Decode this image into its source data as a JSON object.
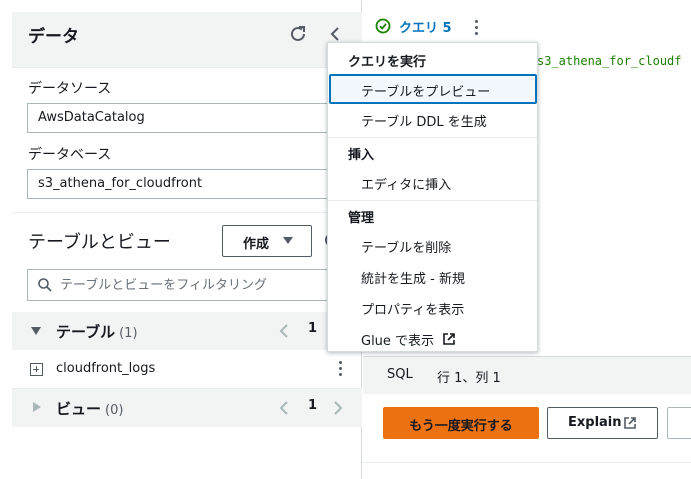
{
  "left_panel": {
    "title": "データ",
    "data_source_label": "データソース",
    "data_source_value": "AwsDataCatalog",
    "database_label": "データベース",
    "database_value": "s3_athena_for_cloudfront",
    "tables_views_title": "テーブルとビュー",
    "create_label": "作成",
    "search_placeholder": "テーブルとビューをフィルタリング",
    "tables": {
      "label": "テーブル",
      "count": "(1)",
      "page": "1",
      "items": [
        "cloudfront_logs"
      ]
    },
    "views": {
      "label": "ビュー",
      "count": "(0)",
      "page": "1"
    }
  },
  "editor": {
    "tab_label": "クエリ 5",
    "code_snippet": "s3_athena_for_cloudf",
    "status_mode": "SQL",
    "status_position": "行 1、列 1",
    "run_again_label": "もう一度実行する",
    "explain_label": "Explain"
  },
  "context_menu": {
    "group_run": "クエリを実行",
    "preview_table": "テーブルをプレビュー",
    "generate_ddl": "テーブル DDL を生成",
    "group_insert": "挿入",
    "insert_editor": "エディタに挿入",
    "group_manage": "管理",
    "delete_table": "テーブルを削除",
    "generate_stats": "統計を生成 - 新規",
    "show_properties": "プロパティを表示",
    "show_in_glue": "Glue で表示"
  },
  "colors": {
    "accent_orange": "#ec7211",
    "link_blue": "#0073bb",
    "success_green": "#1d8102"
  },
  "icons": [
    "refresh-icon",
    "collapse-icon",
    "search-icon",
    "plus-box-icon",
    "kebab-icon",
    "check-circle-icon",
    "external-link-icon",
    "chevron-left-icon",
    "chevron-right-icon"
  ]
}
